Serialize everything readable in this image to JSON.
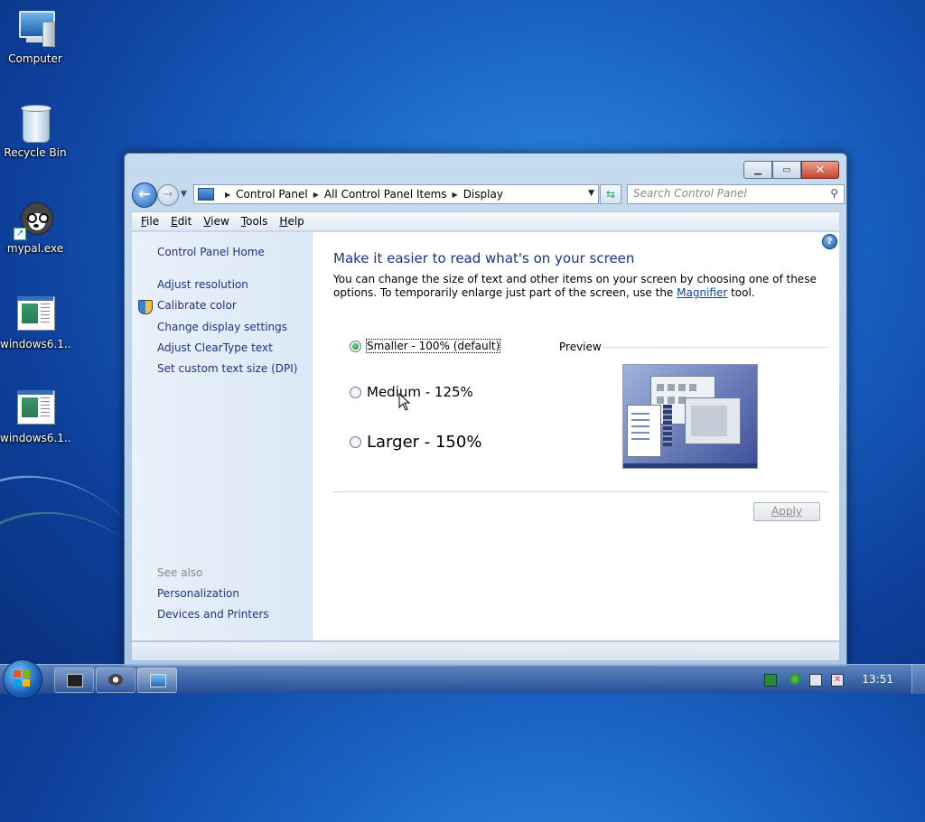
{
  "desktop": {
    "icons": [
      {
        "label": "Computer"
      },
      {
        "label": "Recycle Bin"
      },
      {
        "label": "mypal.exe"
      },
      {
        "label": "windows6.1..."
      },
      {
        "label": "windows6.1..."
      }
    ]
  },
  "window": {
    "address": {
      "segments": [
        "Control Panel",
        "All Control Panel Items",
        "Display"
      ]
    },
    "search": {
      "placeholder": "Search Control Panel"
    },
    "menu": [
      {
        "key": "F",
        "rest": "ile"
      },
      {
        "key": "E",
        "rest": "dit"
      },
      {
        "key": "V",
        "rest": "iew"
      },
      {
        "key": "T",
        "rest": "ools"
      },
      {
        "key": "H",
        "rest": "elp"
      }
    ],
    "left_pane": {
      "home": "Control Panel Home",
      "tasks": [
        "Adjust resolution",
        "Calibrate color",
        "Change display settings",
        "Adjust ClearType text",
        "Set custom text size (DPI)"
      ],
      "see_also_heading": "See also",
      "see_also": [
        "Personalization",
        "Devices and Printers"
      ]
    },
    "main": {
      "title": "Make it easier to read what's on your screen",
      "desc_part1": "You can change the size of text and other items on your screen by choosing one of these options. To temporarily enlarge just part of the screen, use the ",
      "desc_link": "Magnifier",
      "desc_part2": " tool.",
      "options": [
        {
          "label": "Smaller - 100% (default)",
          "selected": true
        },
        {
          "label": "Medium - 125%",
          "selected": false
        },
        {
          "label": "Larger - 150%",
          "selected": false
        }
      ],
      "preview_label": "Preview",
      "apply_label": "Apply",
      "help_icon": "?"
    }
  },
  "taskbar": {
    "clock": "13:51"
  },
  "colors": {
    "link": "#1e3287",
    "accent": "#1a63c4"
  }
}
